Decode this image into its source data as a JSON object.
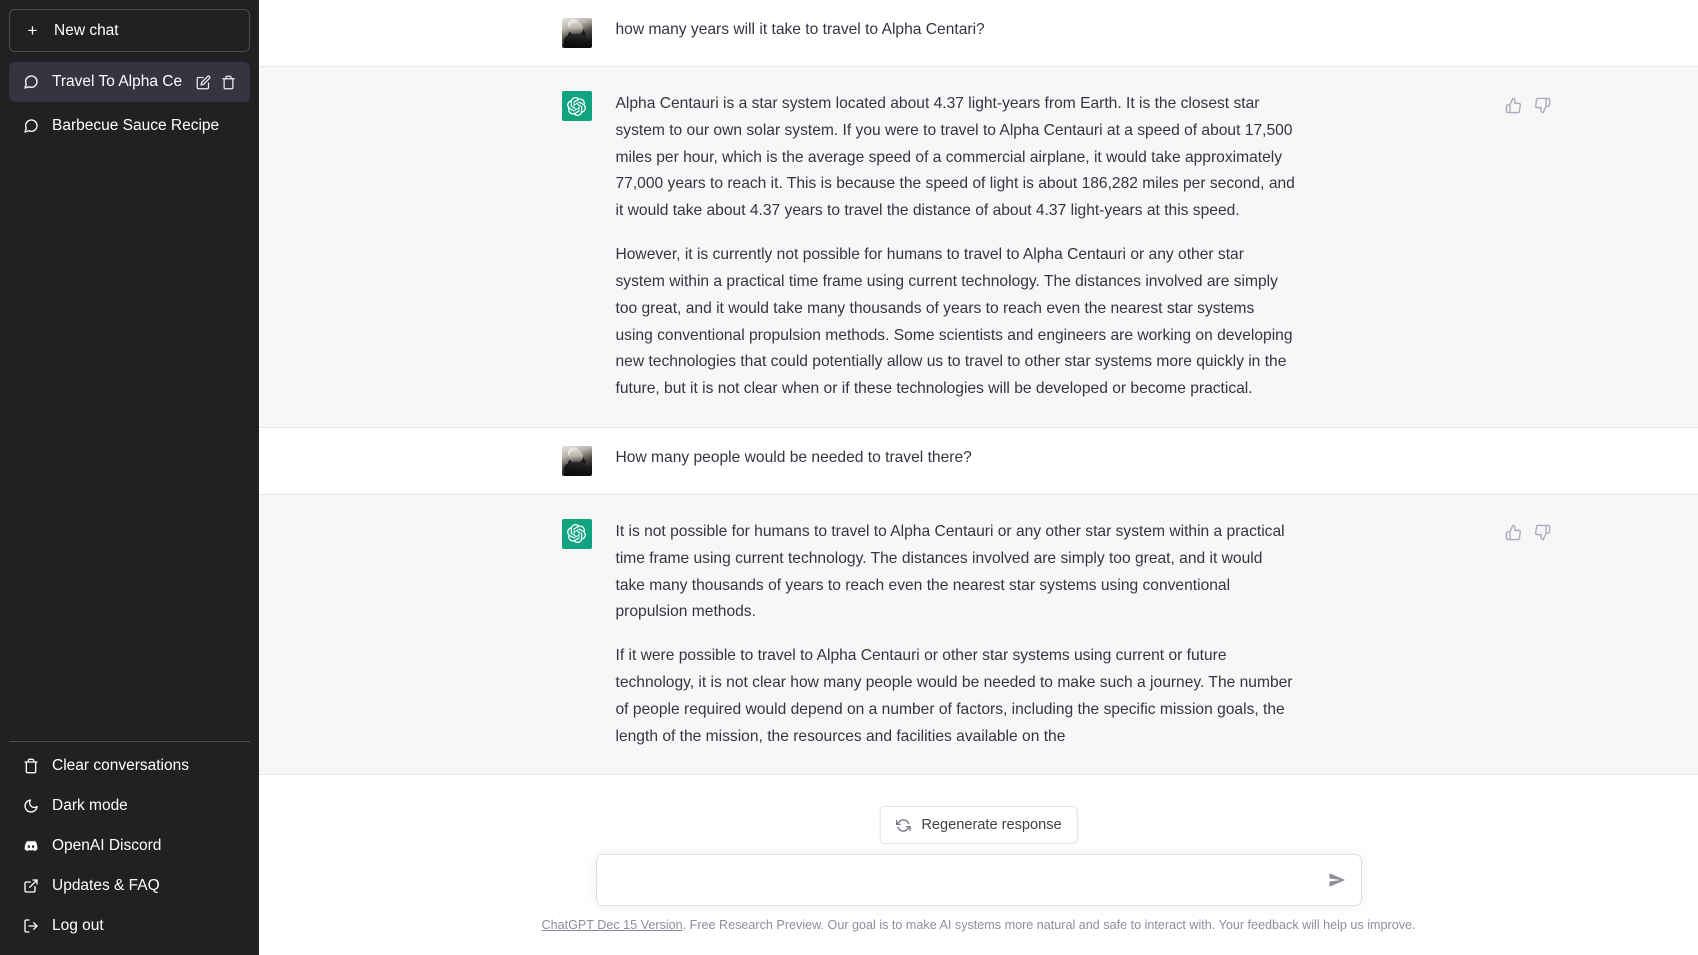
{
  "sidebar": {
    "new_chat": {
      "label": "New chat",
      "icon": "plus-icon"
    },
    "conversations": [
      {
        "label": "Travel To Alpha Centauri",
        "icon": "chat-bubble-icon",
        "active": true,
        "edit_icon": "pencil-icon",
        "delete_icon": "trash-icon"
      },
      {
        "label": "Barbecue Sauce Recipe",
        "icon": "chat-bubble-icon",
        "active": false
      }
    ],
    "menu": [
      {
        "label": "Clear conversations",
        "icon": "trash-icon"
      },
      {
        "label": "Dark mode",
        "icon": "moon-icon"
      },
      {
        "label": "OpenAI Discord",
        "icon": "discord-icon"
      },
      {
        "label": "Updates & FAQ",
        "icon": "external-link-icon"
      },
      {
        "label": "Log out",
        "icon": "logout-icon"
      }
    ]
  },
  "conversation": {
    "messages": [
      {
        "role": "user",
        "avatar": "user-photo-avatar",
        "paragraphs": [
          "how many years will it take to travel to Alpha Centari?"
        ]
      },
      {
        "role": "assistant",
        "avatar": "openai-logo-icon",
        "paragraphs": [
          "Alpha Centauri is a star system located about 4.37 light-years from Earth. It is the closest star system to our own solar system. If you were to travel to Alpha Centauri at a speed of about 17,500 miles per hour, which is the average speed of a commercial airplane, it would take approximately 77,000 years to reach it. This is because the speed of light is about 186,282 miles per second, and it would take about 4.37 years to travel the distance of about 4.37 light-years at this speed.",
          "However, it is currently not possible for humans to travel to Alpha Centauri or any other star system within a practical time frame using current technology. The distances involved are simply too great, and it would take many thousands of years to reach even the nearest star systems using conventional propulsion methods. Some scientists and engineers are working on developing new technologies that could potentially allow us to travel to other star systems more quickly in the future, but it is not clear when or if these technologies will be developed or become practical."
        ],
        "feedback": {
          "like_icon": "thumbs-up-icon",
          "dislike_icon": "thumbs-down-icon"
        }
      },
      {
        "role": "user",
        "avatar": "user-photo-avatar",
        "paragraphs": [
          "How many people would be needed to travel there?"
        ]
      },
      {
        "role": "assistant",
        "avatar": "openai-logo-icon",
        "paragraphs": [
          "It is not possible for humans to travel to Alpha Centauri or any other star system within a practical time frame using current technology. The distances involved are simply too great, and it would take many thousands of years to reach even the nearest star systems using conventional propulsion methods.",
          "If it were possible to travel to Alpha Centauri or other star systems using current or future technology, it is not clear how many people would be needed to make such a journey. The number of people required would depend on a number of factors, including the specific mission goals, the length of the mission, the resources and facilities available on the"
        ],
        "feedback": {
          "like_icon": "thumbs-up-icon",
          "dislike_icon": "thumbs-down-icon"
        }
      }
    ]
  },
  "composer": {
    "regenerate_label": "Regenerate response",
    "regenerate_icon": "refresh-icon",
    "input_value": "",
    "input_placeholder": "",
    "send_icon": "send-arrow-icon"
  },
  "footer": {
    "version_link": "ChatGPT Dec 15 Version",
    "notice": ". Free Research Preview. Our goal is to make AI systems more natural and safe to interact with. Your feedback will help us improve."
  },
  "colors": {
    "sidebar_bg": "#202123",
    "sidebar_active": "#343541",
    "assistant_row_bg": "#f7f7f8",
    "user_row_bg": "#ffffff",
    "brand_green": "#10a37f",
    "text": "#343541",
    "muted": "#8e8ea0"
  }
}
